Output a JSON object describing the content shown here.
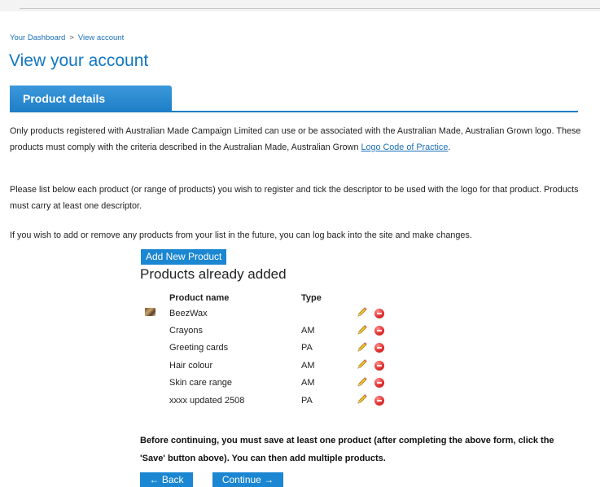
{
  "breadcrumb": {
    "home": "Your Dashboard",
    "separator": ">",
    "current": "View account"
  },
  "page_title": "View your account",
  "section_tab": "Product details",
  "intro": {
    "p1_text": "Only products registered with Australian Made Campaign Limited can use or be associated with the Australian Made, Australian Grown logo. These products must comply with the criteria described in the Australian Made, Australian Grown ",
    "p1_link": "Logo Code of Practice",
    "p1_end": ".",
    "p2": "Please list below each product (or range of products) you wish to register and tick the descriptor to be used with the logo for that product. Products must carry at least one descriptor.",
    "p3": "If you wish to add or remove any products from your list in the future, you can log back into the site and make changes."
  },
  "add_button": "Add New Product",
  "products_heading": "Products already added",
  "table": {
    "col_name": "Product name",
    "col_type": "Type",
    "rows": [
      {
        "name": "BeezWax",
        "type": "",
        "has_thumb": true
      },
      {
        "name": "Crayons",
        "type": "AM"
      },
      {
        "name": "Greeting cards",
        "type": "PA"
      },
      {
        "name": "Hair colour",
        "type": "AM"
      },
      {
        "name": "Skin care range",
        "type": "AM"
      },
      {
        "name": "xxxx updated 2508",
        "type": "PA"
      }
    ]
  },
  "notice": "Before continuing, you must save at least one product (after completing the above form, click the 'Save' button above). You can then add multiple products.",
  "buttons": {
    "back": "← Back",
    "continue": "Continue →"
  },
  "icons": {
    "edit": "pencil-icon",
    "delete": "delete-circle-icon",
    "thumb": "product-thumbnail"
  },
  "colors": {
    "accent": "#1277c4",
    "button": "#1b86d1",
    "delete": "#e02b2b"
  }
}
